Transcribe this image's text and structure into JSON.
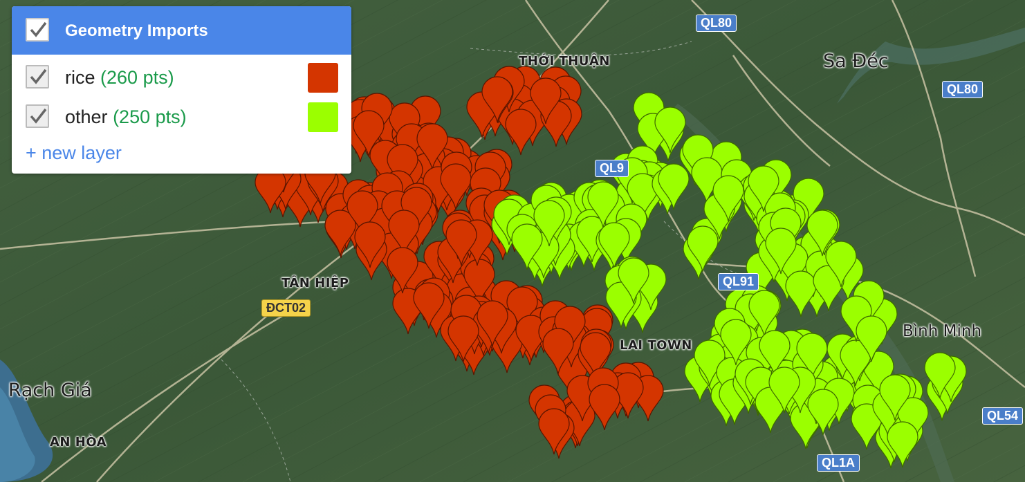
{
  "panel": {
    "title": "Geometry Imports",
    "new_layer_label": "+ new layer",
    "layers": [
      {
        "name": "rice",
        "count": "(260 pts)",
        "color": "#d43500",
        "checked": true
      },
      {
        "name": "other",
        "count": "(250 pts)",
        "color": "#9bff00",
        "checked": true
      }
    ]
  },
  "place_labels": {
    "thoi_thuan": "THỚI THUẬN",
    "sa_dec": "Sa Đéc",
    "tan_hiep": "TÂN HIỆP",
    "lai_town": "LAI TOWN",
    "rach_gia": "Rạch Giá",
    "an_hoa": "AN HÒA",
    "binh_minh": "Bình Minh"
  },
  "road_shields": {
    "ql80_top": "QL80",
    "ql80_right": "QL80",
    "ql91": "QL91",
    "dct02": "ĐCT02",
    "ql1a": "QL1A",
    "ql54": "QL54",
    "ql_partial": "QL9"
  },
  "icons": {
    "checkbox": "checkmark-icon",
    "marker": "map-pin-icon"
  }
}
